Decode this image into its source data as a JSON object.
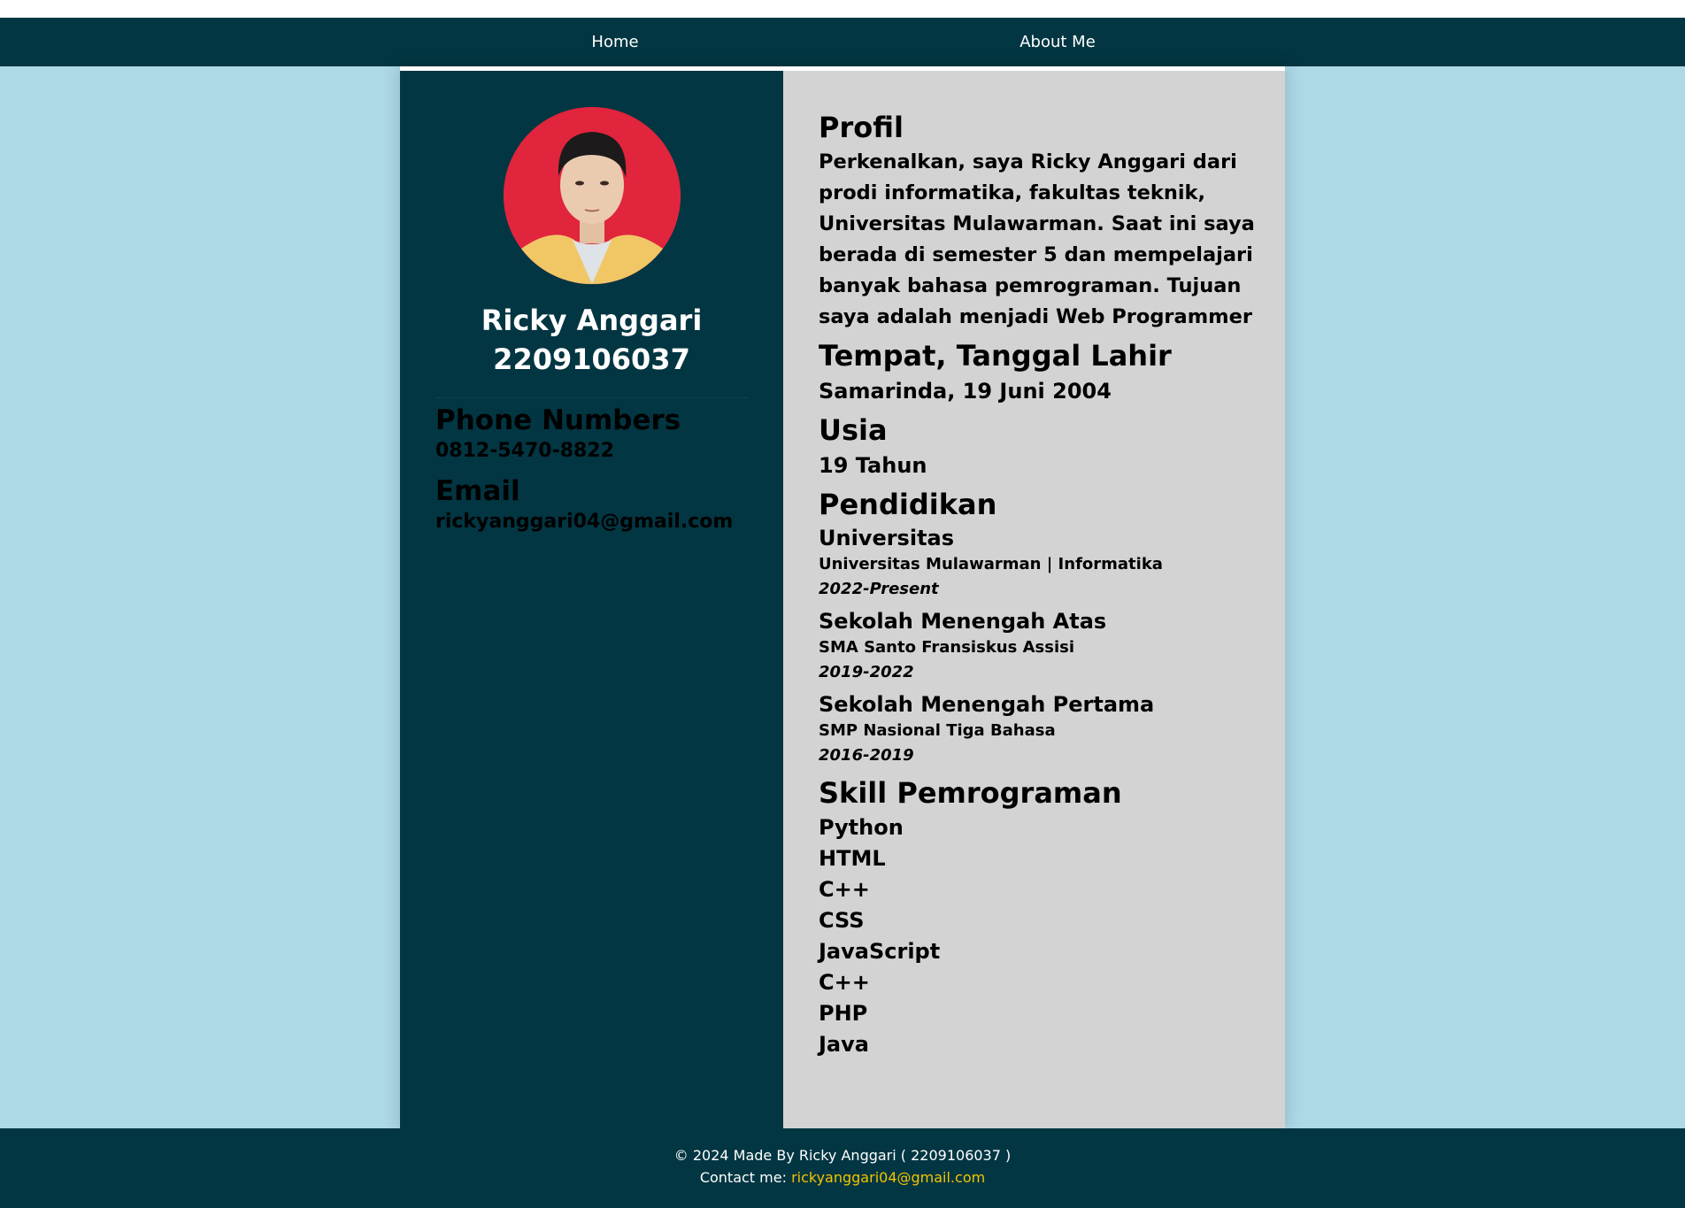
{
  "nav": {
    "home": "Home",
    "about": "About Me"
  },
  "sidebar": {
    "name": "Ricky Anggari",
    "nim": "2209106037",
    "phone_heading": "Phone Numbers",
    "phone": "0812-5470-8822",
    "email_heading": "Email",
    "email": "rickyanggari04@gmail.com"
  },
  "main": {
    "profil_heading": "Profil",
    "profil_text": "Perkenalkan, saya Ricky Anggari dari prodi informatika, fakultas teknik, Universitas Mulawarman. Saat ini saya berada di semester 5 dan mempelajari banyak bahasa pemrograman. Tujuan saya adalah menjadi Web Programmer",
    "ttl_heading": "Tempat, Tanggal Lahir",
    "ttl": "Samarinda, 19 Juni 2004",
    "usia_heading": "Usia",
    "usia": "19 Tahun",
    "pendidikan_heading": "Pendidikan",
    "education": [
      {
        "level": "Universitas",
        "school": "Universitas Mulawarman | Informatika",
        "years": "2022-Present"
      },
      {
        "level": "Sekolah Menengah Atas",
        "school": "SMA Santo Fransiskus Assisi",
        "years": "2019-2022"
      },
      {
        "level": "Sekolah Menengah Pertama",
        "school": "SMP Nasional Tiga Bahasa",
        "years": "2016-2019"
      }
    ],
    "skill_heading": "Skill Pemrograman",
    "skills": [
      "Python",
      "HTML",
      "C++",
      "CSS",
      "JavaScript",
      "C++",
      "PHP",
      "Java"
    ]
  },
  "footer": {
    "credit": "© 2024 Made By Ricky Anggari ( 2209106037 )",
    "contact_label": "Contact me: ",
    "contact_email": "rickyanggari04@gmail.com"
  },
  "colors": {
    "navbar": "#023642",
    "page_bg": "#add8e6",
    "sidebar_bg": "#023642",
    "main_bg": "#d3d3d3",
    "footer_link": "#f5c400"
  }
}
